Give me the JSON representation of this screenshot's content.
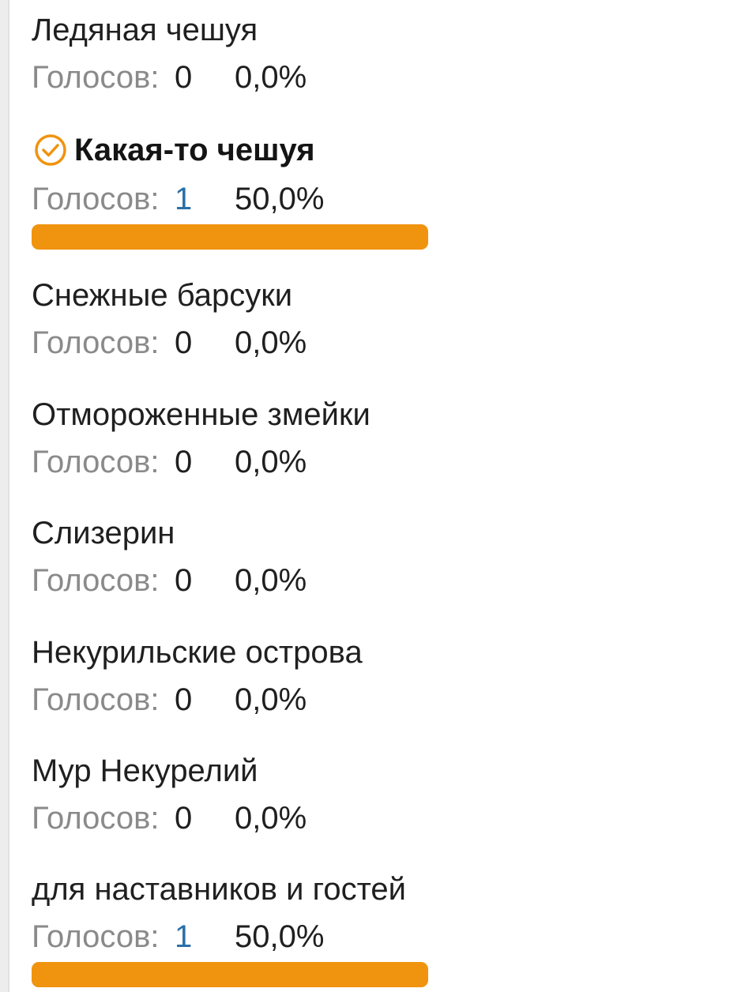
{
  "accent_color": "#f0930f",
  "votes_label": "Голосов:",
  "options": [
    {
      "title": "Ледяная чешуя",
      "votes": "0",
      "percent": "0,0%",
      "fraction": 0.0,
      "chosen": false
    },
    {
      "title": "Какая-то чешуя",
      "votes": "1",
      "percent": "50,0%",
      "fraction": 0.5,
      "chosen": true,
      "icon": "check-circle-icon"
    },
    {
      "title": "Снежные барсуки",
      "votes": "0",
      "percent": "0,0%",
      "fraction": 0.0,
      "chosen": false
    },
    {
      "title": "Отмороженные змейки",
      "votes": "0",
      "percent": "0,0%",
      "fraction": 0.0,
      "chosen": false
    },
    {
      "title": "Слизерин",
      "votes": "0",
      "percent": "0,0%",
      "fraction": 0.0,
      "chosen": false
    },
    {
      "title": "Некурильские острова",
      "votes": "0",
      "percent": "0,0%",
      "fraction": 0.0,
      "chosen": false
    },
    {
      "title": "Мур Некурелий",
      "votes": "0",
      "percent": "0,0%",
      "fraction": 0.0,
      "chosen": false
    },
    {
      "title": "для наставников и гостей",
      "votes": "1",
      "percent": "50,0%",
      "fraction": 0.5,
      "chosen": false
    }
  ]
}
